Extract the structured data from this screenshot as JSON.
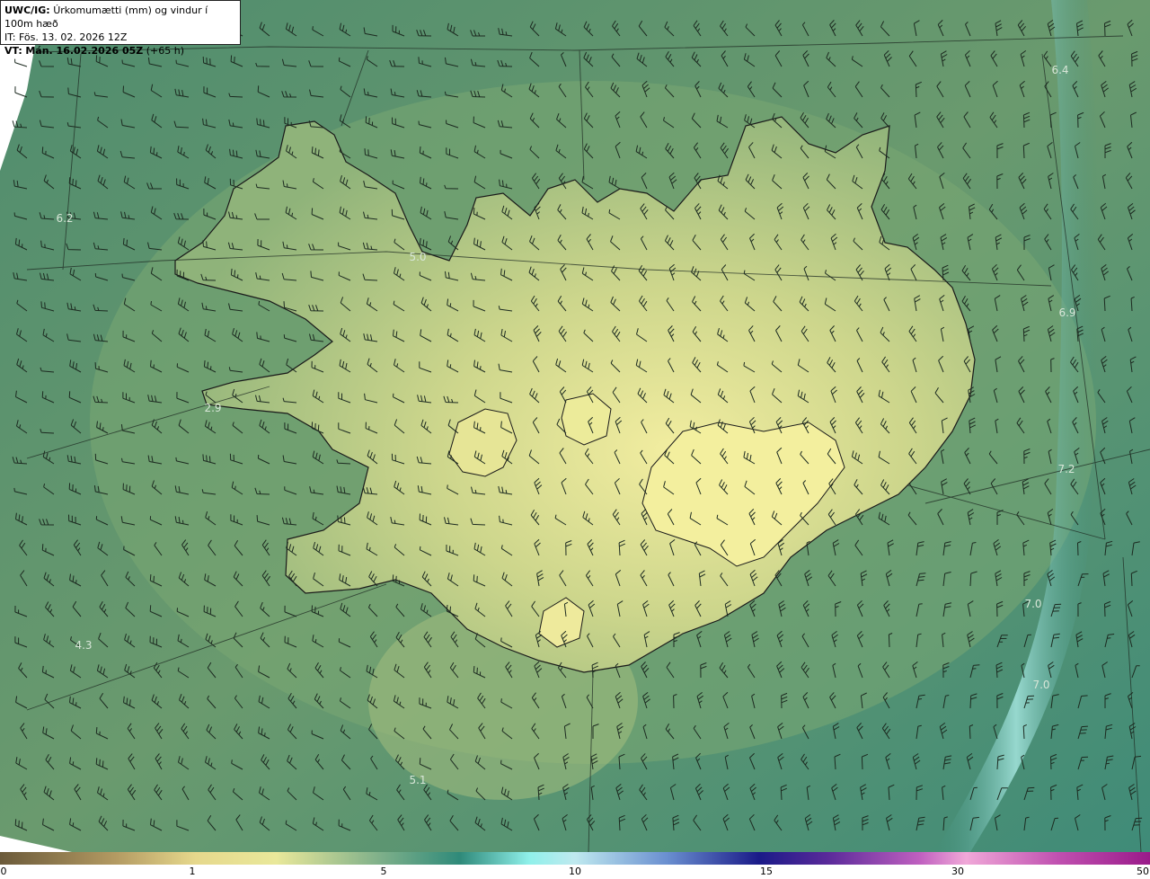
{
  "header": {
    "model_label": "UWC/IG:",
    "title": "Úrkomumætti (mm) og vindur í 100m hæð",
    "init_time": "IT: Fös. 13. 02. 2026 12Z",
    "valid_label": "VT:",
    "valid_time": "Mán. 16.02.2026 05Z",
    "lead_time": "(+65 h)"
  },
  "map": {
    "region": "Iceland",
    "field_values": [
      {
        "id": "v1",
        "text": "6.4"
      },
      {
        "id": "v2",
        "text": "6.2"
      },
      {
        "id": "v3",
        "text": "5.0"
      },
      {
        "id": "v4",
        "text": "6.9"
      },
      {
        "id": "v5",
        "text": "2.9"
      },
      {
        "id": "v6",
        "text": "7.2"
      },
      {
        "id": "v7",
        "text": "7.0"
      },
      {
        "id": "v8",
        "text": "4.3"
      },
      {
        "id": "v9",
        "text": "7.0"
      },
      {
        "id": "v10",
        "text": "5.1"
      }
    ]
  },
  "colorbar": {
    "ticks": [
      "0",
      "1",
      "5",
      "10",
      "15",
      "30",
      "50"
    ],
    "colors": [
      "#6b5a3a",
      "#b39a62",
      "#e6d88c",
      "#e9e89a",
      "#7fb08a",
      "#2f8a7a",
      "#8ff0ea",
      "#bfe9ef",
      "#6a8fd0",
      "#1a1a88",
      "#5a2a9a",
      "#c060c0",
      "#f0a8d8",
      "#c050b0",
      "#9a1a8a"
    ]
  }
}
